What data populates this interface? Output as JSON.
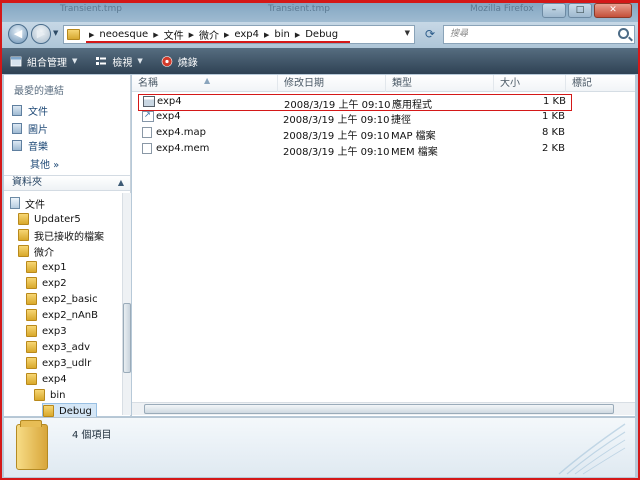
{
  "window": {
    "ghost_titles": [
      "Transient.tmp",
      "Transient.tmp",
      "Mozilla Firefox"
    ],
    "controls": {
      "minimize": "–",
      "maximize": "□",
      "close": "✕"
    }
  },
  "address_bar": {
    "breadcrumbs": [
      "neoesque",
      "文件",
      "微介",
      "exp4",
      "bin",
      "Debug"
    ],
    "search_placeholder": "搜尋"
  },
  "toolbar": {
    "organize": "組合管理",
    "views": "檢視",
    "burn": "燒錄"
  },
  "sidebar": {
    "favorites_title": "最愛的連結",
    "favorites": [
      "文件",
      "圖片",
      "音樂"
    ],
    "more": "其他 »",
    "folders_title": "資料夾",
    "tree": [
      {
        "label": "文件",
        "level": 0,
        "kind": "doc"
      },
      {
        "label": "Updater5",
        "level": 1,
        "kind": "folder"
      },
      {
        "label": "我已接收的檔案",
        "level": 1,
        "kind": "folder"
      },
      {
        "label": "微介",
        "level": 1,
        "kind": "folder"
      },
      {
        "label": "exp1",
        "level": 2,
        "kind": "folder"
      },
      {
        "label": "exp2",
        "level": 2,
        "kind": "folder"
      },
      {
        "label": "exp2_basic",
        "level": 2,
        "kind": "folder"
      },
      {
        "label": "exp2_nAnB",
        "level": 2,
        "kind": "folder"
      },
      {
        "label": "exp3",
        "level": 2,
        "kind": "folder"
      },
      {
        "label": "exp3_adv",
        "level": 2,
        "kind": "folder"
      },
      {
        "label": "exp3_udlr",
        "level": 2,
        "kind": "folder"
      },
      {
        "label": "exp4",
        "level": 2,
        "kind": "folder"
      },
      {
        "label": "bin",
        "level": 3,
        "kind": "folder"
      },
      {
        "label": "Debug",
        "level": 4,
        "kind": "folder",
        "selected": true
      }
    ]
  },
  "file_list": {
    "columns": [
      "名稱",
      "修改日期",
      "類型",
      "大小",
      "標記"
    ],
    "rows": [
      {
        "name": "exp4",
        "date": "2008/3/19 上午 09:10",
        "type": "應用程式",
        "size": "1 KB",
        "icon": "exe",
        "highlighted": true
      },
      {
        "name": "exp4",
        "date": "2008/3/19 上午 09:10",
        "type": "捷徑",
        "size": "1 KB",
        "icon": "lnk"
      },
      {
        "name": "exp4.map",
        "date": "2008/3/19 上午 09:10",
        "type": "MAP 檔案",
        "size": "8 KB",
        "icon": "doc"
      },
      {
        "name": "exp4.mem",
        "date": "2008/3/19 上午 09:10",
        "type": "MEM 檔案",
        "size": "2 KB",
        "icon": "doc"
      }
    ]
  },
  "details": {
    "item_count": "4 個項目"
  }
}
